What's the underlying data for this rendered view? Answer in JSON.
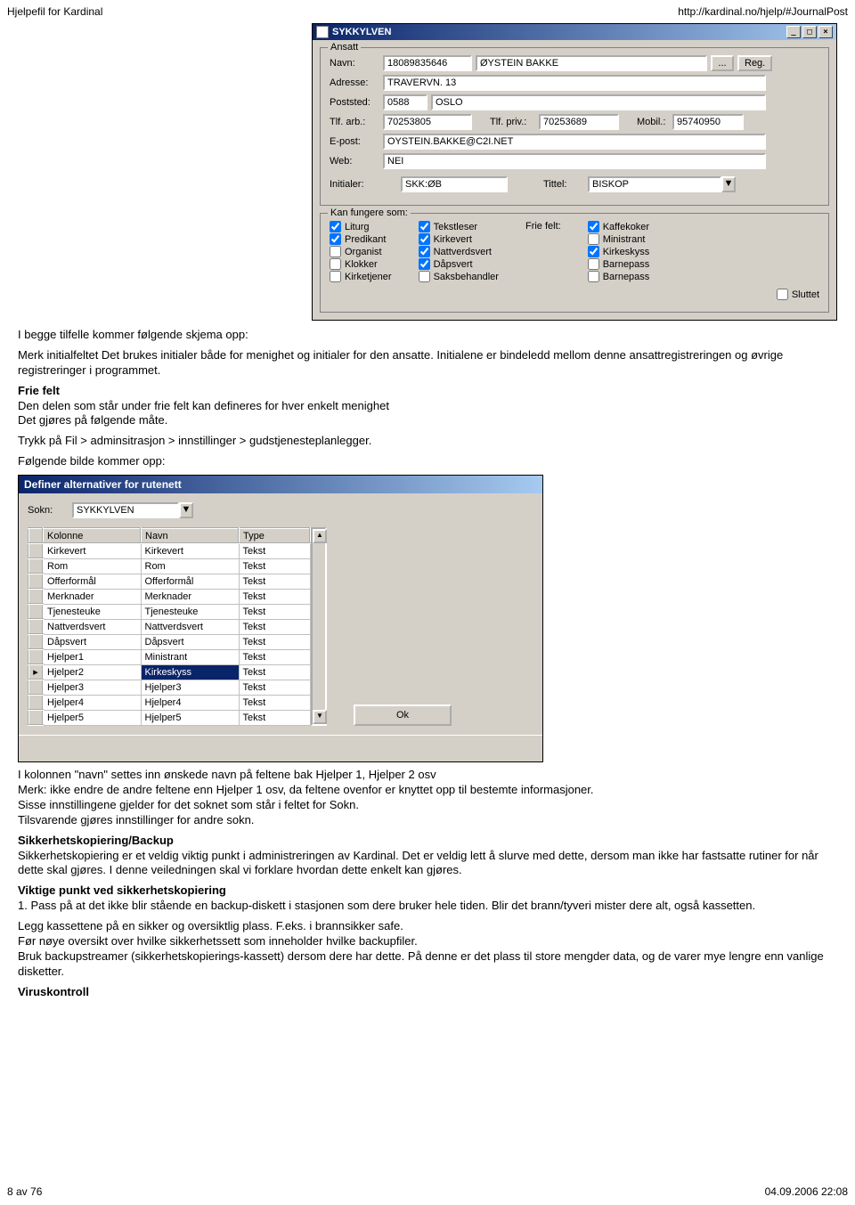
{
  "header": {
    "left": "Hjelpefil for Kardinal",
    "right": "http://kardinal.no/hjelp/#JournalPost"
  },
  "win1": {
    "title": "SYKKYLVEN",
    "legend_ansatt": "Ansatt",
    "labels": {
      "navn": "Navn:",
      "adresse": "Adresse:",
      "poststed": "Poststed:",
      "tlfarb": "Tlf. arb.:",
      "tlfpriv": "Tlf. priv.:",
      "mobil": "Mobil.:",
      "epost": "E-post:",
      "web": "Web:",
      "initialer": "Initialer:",
      "tittel": "Tittel:"
    },
    "vals": {
      "navn_nr": "18089835646",
      "navn": "ØYSTEIN BAKKE",
      "adresse": "TRAVERVN. 13",
      "postnr": "0588",
      "poststed": "OSLO",
      "tlfarb": "70253805",
      "tlfpriv": "70253689",
      "mobil": "95740950",
      "epost": "OYSTEIN.BAKKE@C2I.NET",
      "web": "NEI",
      "initialer": "SKK:ØB",
      "tittel": "BISKOP"
    },
    "btn_dots": "...",
    "btn_reg": "Reg.",
    "legend_fungere": "Kan fungere som:",
    "cb_col1": [
      "Liturg",
      "Predikant",
      "Organist",
      "Klokker",
      "Kirketjener"
    ],
    "cb_col1_checked": [
      true,
      true,
      false,
      false,
      false
    ],
    "cb_col2": [
      "Tekstleser",
      "Kirkevert",
      "Nattverdsvert",
      "Dåpsvert",
      "Saksbehandler"
    ],
    "cb_col2_checked": [
      true,
      true,
      true,
      true,
      false
    ],
    "frie_felt_label": "Frie felt:",
    "cb_col3": [
      "Kaffekoker",
      "Ministrant",
      "Kirkeskyss",
      "Barnepass",
      "Barnepass"
    ],
    "cb_col3_checked": [
      true,
      false,
      true,
      false,
      false
    ],
    "sluttet_label": "Sluttet"
  },
  "text1": {
    "p1": "I begge tilfelle kommer følgende skjema opp:",
    "p2": "Merk initialfeltet Det brukes initialer både for menighet og initialer for den ansatte. Initialene er bindeledd mellom denne ansattregistreringen og øvrige registreringer i programmet.",
    "h_frie": "Frie felt",
    "p3": "Den delen som står under frie felt kan defineres for hver enkelt menighet",
    "p4": "Det gjøres på følgende måte.",
    "p5": "Trykk på Fil > adminsitrasjon > innstillinger > gudstjenesteplanlegger.",
    "p6": "Følgende bilde kommer opp:"
  },
  "win2": {
    "title": "Definer alternativer for rutenett",
    "sokn_label": "Sokn:",
    "sokn_val": "SYKKYLVEN",
    "cols": [
      "Kolonne",
      "Navn",
      "Type"
    ],
    "rows": [
      [
        "Kirkevert",
        "Kirkevert",
        "Tekst"
      ],
      [
        "Rom",
        "Rom",
        "Tekst"
      ],
      [
        "Offerformål",
        "Offerformål",
        "Tekst"
      ],
      [
        "Merknader",
        "Merknader",
        "Tekst"
      ],
      [
        "Tjenesteuke",
        "Tjenesteuke",
        "Tekst"
      ],
      [
        "Nattverdsvert",
        "Nattverdsvert",
        "Tekst"
      ],
      [
        "Dåpsvert",
        "Dåpsvert",
        "Tekst"
      ],
      [
        "Hjelper1",
        "Ministrant",
        "Tekst"
      ],
      [
        "Hjelper2",
        "Kirkeskyss",
        "Tekst"
      ],
      [
        "Hjelper3",
        "Hjelper3",
        "Tekst"
      ],
      [
        "Hjelper4",
        "Hjelper4",
        "Tekst"
      ],
      [
        "Hjelper5",
        "Hjelper5",
        "Tekst"
      ]
    ],
    "selected_row": 8,
    "ok": "Ok"
  },
  "text2": {
    "p1": "I kolonnen \"navn\" settes inn ønskede navn på feltene bak Hjelper 1, Hjelper 2 osv",
    "p2": "Merk: ikke endre de andre feltene enn Hjelper 1 osv, da feltene ovenfor er knyttet opp til bestemte informasjoner.",
    "p3": "Sisse innstillingene gjelder for det soknet som står i feltet for Sokn.",
    "p4": "Tilsvarende gjøres innstillinger for andre sokn.",
    "h_backup": "Sikkerhetskopiering/Backup",
    "p5": "Sikkerhetskopiering er et veldig viktig punkt i administreringen av Kardinal. Det er veldig lett å slurve med dette, dersom man ikke har fastsatte rutiner for når dette skal gjøres. I denne veiledningen skal vi forklare hvordan dette enkelt kan gjøres.",
    "h_viktig": "Viktige punkt ved sikkerhetskopiering",
    "p6": "1. Pass på at det ikke blir stående en backup-diskett i stasjonen som dere bruker hele tiden. Blir det brann/tyveri mister dere alt, også kassetten.",
    "p7": "Legg kassettene på en sikker og oversiktlig plass. F.eks. i brannsikker safe.",
    "p8": "Før nøye oversikt over hvilke sikkerhetssett som inneholder hvilke backupfiler.",
    "p9": "Bruk backupstreamer (sikkerhetskopierings-kassett) dersom dere har dette. På denne er det plass til store mengder data, og de varer mye lengre enn vanlige disketter.",
    "h_virus": "Viruskontroll"
  },
  "footer": {
    "left": "8 av 76",
    "right": "04.09.2006 22:08"
  }
}
